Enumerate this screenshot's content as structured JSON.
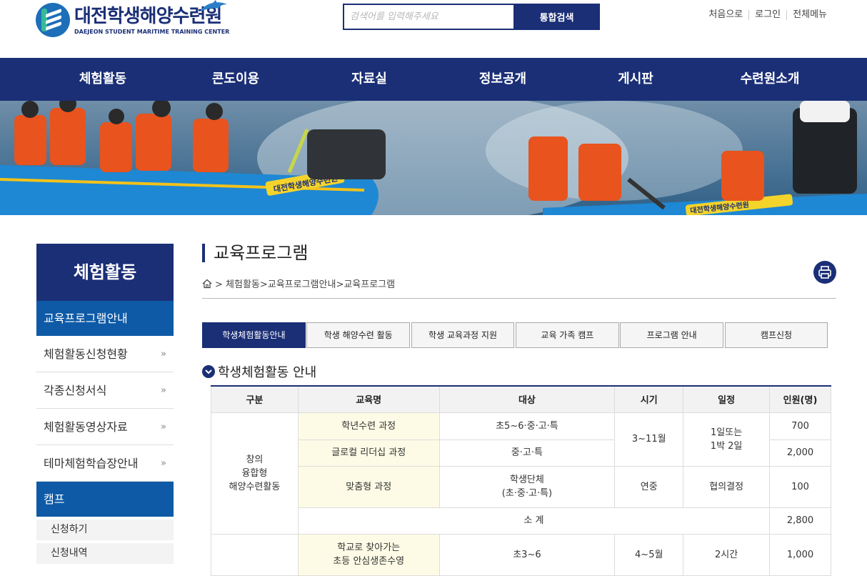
{
  "header": {
    "logo_ko": "대전학생해양수련원",
    "logo_en": "DAEJEON STUDENT MARITIME TRAINING CENTER",
    "search_placeholder": "검색어를 입력해주세요",
    "search_button": "통합검색",
    "util": [
      "처음으로",
      "로그인",
      "전체메뉴"
    ]
  },
  "gnb": [
    "체험활동",
    "콘도이용",
    "자료실",
    "정보공개",
    "게시판",
    "수련원소개"
  ],
  "banner": {
    "boat_label_left": "대전학생해양수련원",
    "boat_label_right": "대전학생해양수련원"
  },
  "sidebar": {
    "title": "체험활동",
    "active": "교육프로그램안내",
    "items": [
      "체험활동신청현황",
      "각종신청서식",
      "체험활동영상자료",
      "테마체험학습장안내"
    ],
    "camp": "캠프",
    "camp_sub": [
      "신청하기",
      "신청내역"
    ]
  },
  "content": {
    "title": "교육프로그램",
    "breadcrumb": "> 체험활동>교육프로그램안내>교육프로그램",
    "tabs": [
      "학생체험활동안내",
      "학생 해양수련 활동",
      "학생 교육과정 지원",
      "교육 가족 캠프",
      "프로그램 안내",
      "캠프신청"
    ],
    "section_title": "학생체험활동 안내"
  },
  "table": {
    "headers": [
      "구분",
      "교육명",
      "대상",
      "시기",
      "일정",
      "인원(명)"
    ],
    "group1": "창의\n융합형\n해양수련활동",
    "rows": [
      {
        "name": "학년수련 과정",
        "target": "초5~6·중·고·특",
        "count": "700"
      },
      {
        "name": "글로컬 리더십 과정",
        "target": "중·고·특",
        "count": "2,000"
      },
      {
        "name": "맞춤형 과정",
        "target": "학생단체\n(초·중·고·특)",
        "period": "연중",
        "schedule": "협의결정",
        "count": "100"
      }
    ],
    "period_shared": "3~11월",
    "schedule_shared": "1일또는\n1박 2일",
    "subtotal_label": "소 계",
    "subtotal_value": "2,800",
    "row5": {
      "name": "학교로 찾아가는\n초등 안심생존수영",
      "target": "초3~6",
      "period": "4~5월",
      "schedule": "2시간",
      "count": "1,000"
    }
  }
}
